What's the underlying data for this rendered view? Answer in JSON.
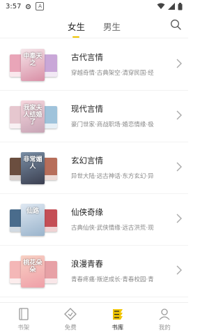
{
  "status": {
    "time": "3:57",
    "sim_label": "A"
  },
  "tabs": [
    {
      "label": "女生",
      "active": true
    },
    {
      "label": "男生",
      "active": false
    }
  ],
  "categories": [
    {
      "title": "古代言情",
      "tags": "穿越奇情·古典架空·清穿民国·经",
      "cover_text": "中奉天之",
      "colors": [
        "#e9a5b8",
        "#f5e6ea",
        "#c9a7d8"
      ]
    },
    {
      "title": "现代言情",
      "tags": "豪门世家·商战职场·婚恋情缘·极",
      "cover_text": "我家夫人结婚了",
      "colors": [
        "#e6c7cf",
        "#f7d7de",
        "#9fc3db"
      ]
    },
    {
      "title": "玄幻言情",
      "tags": "异世大陆·远古神话·东方玄幻·异",
      "cover_text": "非常媚人",
      "colors": [
        "#6b4e3f",
        "#7a8fa6",
        "#b76e5a"
      ]
    },
    {
      "title": "仙侠奇缘",
      "tags": "古典仙侠·武侠情缘·远古洪荒·现",
      "cover_text": "仙路",
      "colors": [
        "#4a6c8c",
        "#9ab4cc",
        "#c44f56"
      ]
    },
    {
      "title": "浪漫青春",
      "tags": "青春疼痛·叛逆成长·青春校园·青",
      "cover_text": "桃花朵朵",
      "colors": [
        "#f4b7b7",
        "#f8d1c4",
        "#e7a1a6"
      ]
    }
  ],
  "bottom_nav": [
    {
      "label": "书架",
      "icon": "bookshelf-icon",
      "active": false
    },
    {
      "label": "免费",
      "icon": "free-icon",
      "active": false
    },
    {
      "label": "书库",
      "icon": "library-icon",
      "active": true
    },
    {
      "label": "我的",
      "icon": "profile-icon",
      "active": false
    }
  ],
  "accent": "#f0c400"
}
